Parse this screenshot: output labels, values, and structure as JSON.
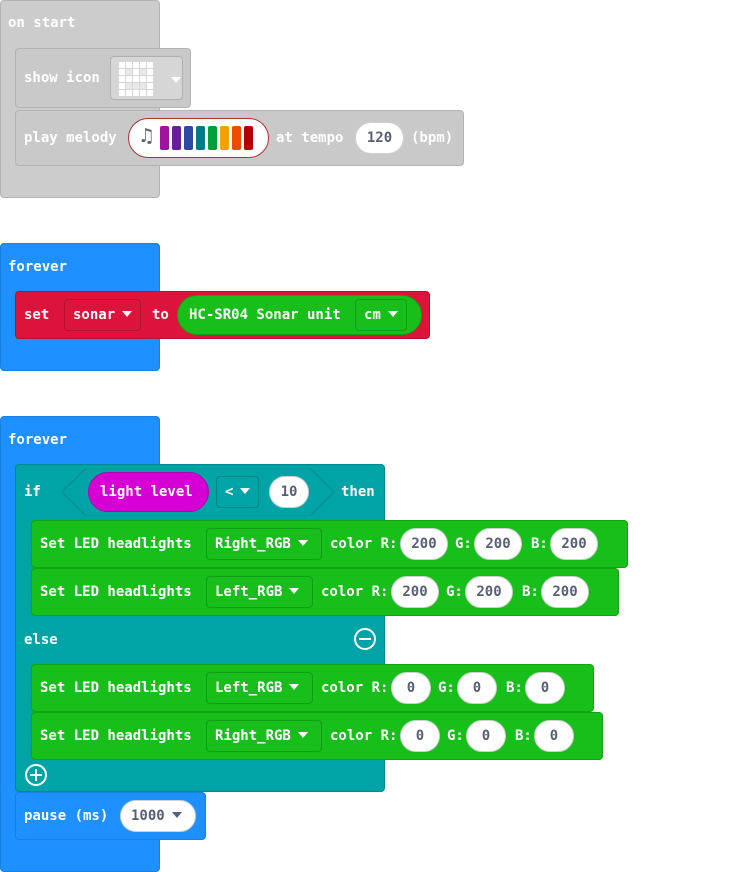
{
  "on_start": {
    "title": "on start",
    "show_icon": {
      "label": "show icon"
    },
    "play_melody": {
      "label": "play melody",
      "at_tempo": "at tempo",
      "tempo": "120",
      "unit": "(bpm)",
      "note_colors": [
        "#a0139c",
        "#6a1b9a",
        "#2e4aa0",
        "#007a87",
        "#009f3c",
        "#f4a100",
        "#ee4a00",
        "#b00000"
      ]
    }
  },
  "forever1": {
    "title": "forever",
    "set": {
      "label": "set",
      "variable": "sonar",
      "to": "to",
      "sonar_label": "HC-SR04 Sonar unit",
      "unit": "cm"
    }
  },
  "forever2": {
    "title": "forever",
    "if_label": "if",
    "then_label": "then",
    "else_label": "else",
    "condition": {
      "sensor": "light level",
      "operator": "<",
      "value": "10"
    },
    "then_blocks": [
      {
        "label": "Set LED headlights",
        "light": "Right_RGB",
        "color": "color R:",
        "r": "200",
        "g_label": "G:",
        "g": "200",
        "b_label": "B:",
        "b": "200"
      },
      {
        "label": "Set LED headlights",
        "light": "Left_RGB",
        "color": "color R:",
        "r": "200",
        "g_label": "G:",
        "g": "200",
        "b_label": "B:",
        "b": "200"
      }
    ],
    "else_blocks": [
      {
        "label": "Set LED headlights",
        "light": "Left_RGB",
        "color": "color R:",
        "r": "0",
        "g_label": "G:",
        "g": "0",
        "b_label": "B:",
        "b": "0"
      },
      {
        "label": "Set LED headlights",
        "light": "Right_RGB",
        "color": "color R:",
        "r": "0",
        "g_label": "G:",
        "g": "0",
        "b_label": "B:",
        "b": "0"
      }
    ],
    "pause": {
      "label": "pause (ms)",
      "value": "1000"
    }
  },
  "colors": {
    "events_gray": "#cccccc",
    "loops_blue": "#1e90ff",
    "variables_red": "#dc143c",
    "extension_green": "#18bf1a",
    "logic_teal": "#00a4a6",
    "input_magenta": "#d400d4"
  }
}
